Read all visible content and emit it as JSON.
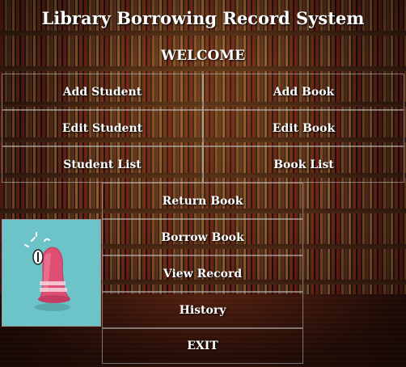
{
  "app": {
    "title": "Library Borrowing Record System",
    "welcome": "WELCOME"
  },
  "menu": {
    "add_student": "Add Student",
    "add_book": "Add Book",
    "edit_student": "Edit Student",
    "edit_book": "Edit Book",
    "student_list": "Student List",
    "book_list": "Book List",
    "return_book": "Return Book",
    "borrow_book": "Borrow Book",
    "view_record": "View Record",
    "history": "History",
    "exit": "EXIT"
  },
  "picture": {
    "icon": "bell-icon",
    "background_color": "#6cc4c8"
  }
}
